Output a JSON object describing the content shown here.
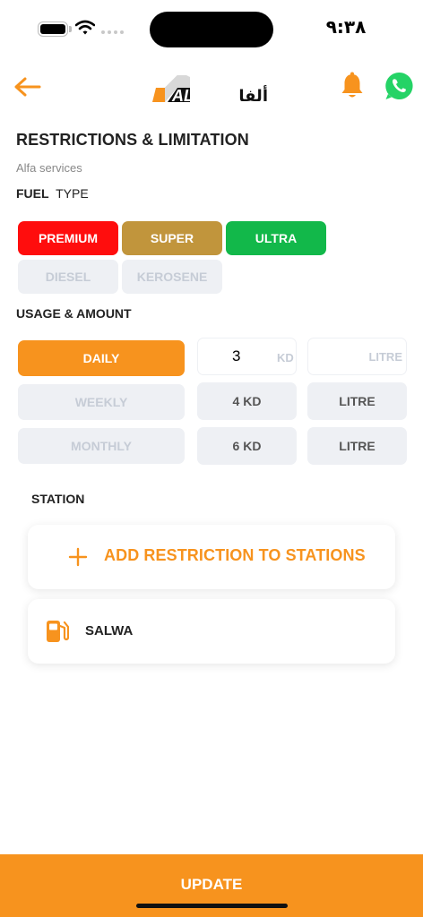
{
  "status_bar": {
    "time": "٩:٣٨"
  },
  "header": {
    "logo_text_latin": "ALFA",
    "logo_text_arabic": "ألفا"
  },
  "page": {
    "title": "RESTRICTIONS & LIMITATION",
    "subtitle": "Alfa services"
  },
  "fuel": {
    "heading_bold": "FUEL",
    "heading_rest": "TYPE",
    "types": [
      {
        "label": "PREMIUM",
        "color": "#ff0d0d",
        "active": true
      },
      {
        "label": "SUPER",
        "color": "#c1953c",
        "active": true
      },
      {
        "label": "ULTRA",
        "color": "#12b84a",
        "active": true
      },
      {
        "label": "DIESEL",
        "active": false
      },
      {
        "label": "KEROSENE",
        "active": false
      }
    ]
  },
  "usage": {
    "heading": "USAGE & AMOUNT",
    "rows": [
      {
        "period": "DAILY",
        "amount_value": "3",
        "amount_unit": "KD",
        "unit": "LITRE"
      },
      {
        "period": "WEEKLY",
        "amount": "4 KD",
        "unit": "LITRE"
      },
      {
        "period": "MONTHLY",
        "amount": "6 KD",
        "unit": "LITRE"
      }
    ]
  },
  "station": {
    "heading": "STATION",
    "add_label": "ADD RESTRICTION TO STATIONS",
    "items": [
      {
        "name": "SALWA"
      }
    ]
  },
  "footer": {
    "update_label": "UPDATE"
  },
  "colors": {
    "accent": "#f7931e",
    "whatsapp": "#25d366"
  }
}
